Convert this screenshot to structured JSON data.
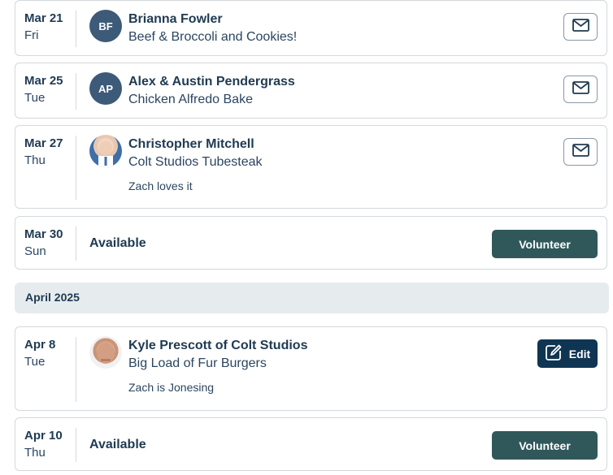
{
  "march_entries": [
    {
      "date": "Mar 21",
      "weekday": "Fri",
      "avatar_initials": "BF",
      "name": "Brianna Fowler",
      "meal": "Beef & Broccoli and Cookies!",
      "action_icon": "mail-icon"
    },
    {
      "date": "Mar 25",
      "weekday": "Tue",
      "avatar_initials": "AP",
      "name": "Alex & Austin Pendergrass",
      "meal": "Chicken Alfredo Bake",
      "action_icon": "mail-icon"
    },
    {
      "date": "Mar 27",
      "weekday": "Thu",
      "avatar_initials": "",
      "name": "Christopher Mitchell",
      "meal": "Colt Studios Tubesteak",
      "note": "Zach loves it",
      "action_icon": "mail-icon"
    },
    {
      "date": "Mar 30",
      "weekday": "Sun",
      "status": "Available",
      "button": "Volunteer"
    }
  ],
  "month_header": "April 2025",
  "april_entries": [
    {
      "date": "Apr 8",
      "weekday": "Tue",
      "avatar_initials": "",
      "name": "Kyle Prescott of Colt Studios",
      "meal": "Big Load of Fur Burgers",
      "note": "Zach is Jonesing",
      "button": "Edit",
      "button_icon": "edit-icon"
    },
    {
      "date": "Apr 10",
      "weekday": "Thu",
      "status": "Available",
      "button": "Volunteer"
    }
  ],
  "colors": {
    "volunteer_button": "#30585a",
    "edit_button": "#0f3553",
    "month_header_bg": "#e6ecee",
    "avatar_bg": "#3d5a78"
  }
}
